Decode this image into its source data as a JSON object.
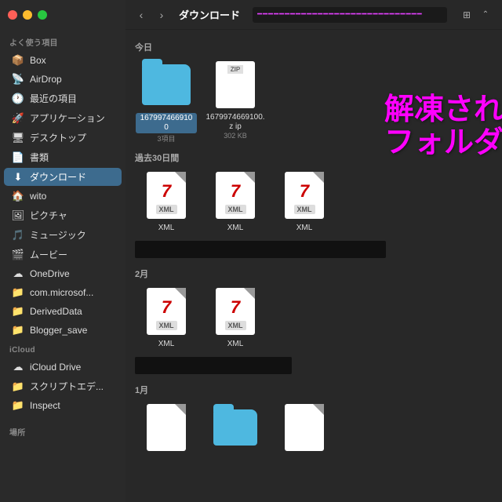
{
  "window": {
    "title": "ダウンロード",
    "path_bar_text": "xxxxxxxxxxxxxxxxxxxxxxxxxxxxxxxxxxxxxxxx"
  },
  "sidebar": {
    "section_favorites": "よく使う項目",
    "section_icloud": "iCloud",
    "section_places": "場所",
    "items": [
      {
        "id": "box",
        "label": "Box",
        "icon": "📦",
        "active": false
      },
      {
        "id": "airdrop",
        "label": "AirDrop",
        "icon": "📡",
        "active": false
      },
      {
        "id": "recents",
        "label": "最近の項目",
        "icon": "🕐",
        "active": false
      },
      {
        "id": "applications",
        "label": "アプリケーション",
        "icon": "🚀",
        "active": false
      },
      {
        "id": "desktop",
        "label": "デスクトップ",
        "icon": "🖥",
        "active": false
      },
      {
        "id": "documents",
        "label": "書類",
        "icon": "📄",
        "active": false
      },
      {
        "id": "downloads",
        "label": "ダウンロード",
        "icon": "⬇",
        "active": true
      },
      {
        "id": "wito",
        "label": "wito",
        "icon": "🏠",
        "active": false
      },
      {
        "id": "pictures",
        "label": "ピクチャ",
        "icon": "🖼",
        "active": false
      },
      {
        "id": "music",
        "label": "ミュージック",
        "icon": "🎵",
        "active": false
      },
      {
        "id": "movies",
        "label": "ムービー",
        "icon": "🎬",
        "active": false
      },
      {
        "id": "onedrive",
        "label": "OneDrive",
        "icon": "☁",
        "active": false
      },
      {
        "id": "com-microsoft",
        "label": "com.microsof...",
        "icon": "📁",
        "active": false
      },
      {
        "id": "deriveddata",
        "label": "DerivedData",
        "icon": "📁",
        "active": false
      },
      {
        "id": "blogger-save",
        "label": "Blogger_save",
        "icon": "📁",
        "active": false
      }
    ],
    "icloud_items": [
      {
        "id": "icloud-drive",
        "label": "iCloud Drive",
        "icon": "☁",
        "active": false
      },
      {
        "id": "script-editor",
        "label": "スクリプトエデ...",
        "icon": "📁",
        "active": false
      },
      {
        "id": "inspect",
        "label": "Inspect",
        "icon": "📁",
        "active": false
      }
    ]
  },
  "main": {
    "sections": [
      {
        "id": "today",
        "header": "今日",
        "files": [
          {
            "id": "folder-1679",
            "type": "folder",
            "name": "1679974669100",
            "meta": "3項目",
            "selected": true
          },
          {
            "id": "zip-1679",
            "type": "zip",
            "name": "1679974669100.z ip",
            "meta": "302 KB",
            "selected": false
          }
        ]
      },
      {
        "id": "last30days",
        "header": "過去30日間",
        "files": [
          {
            "id": "xml1",
            "type": "xml",
            "name": "XML",
            "meta": ""
          },
          {
            "id": "xml2",
            "type": "xml",
            "name": "XML",
            "meta": ""
          },
          {
            "id": "xml3",
            "type": "xml",
            "name": "XML",
            "meta": ""
          }
        ],
        "has_redacted": true
      },
      {
        "id": "february",
        "header": "2月",
        "files": [
          {
            "id": "xml4",
            "type": "xml",
            "name": "XML",
            "meta": ""
          },
          {
            "id": "xml5",
            "type": "xml",
            "name": "XML",
            "meta": ""
          }
        ],
        "has_redacted": true
      },
      {
        "id": "january",
        "header": "1月",
        "files": [
          {
            "id": "file6",
            "type": "generic",
            "name": "",
            "meta": ""
          },
          {
            "id": "file7",
            "type": "folder-blue",
            "name": "",
            "meta": ""
          },
          {
            "id": "file8",
            "type": "generic",
            "name": "",
            "meta": ""
          }
        ],
        "has_redacted": false
      }
    ]
  },
  "annotation": {
    "line1": "解凍された",
    "line2": "フォルダ"
  },
  "nav": {
    "back_label": "‹",
    "forward_label": "›"
  },
  "view": {
    "grid_icon": "⊞",
    "chevron_icon": "⌃"
  }
}
